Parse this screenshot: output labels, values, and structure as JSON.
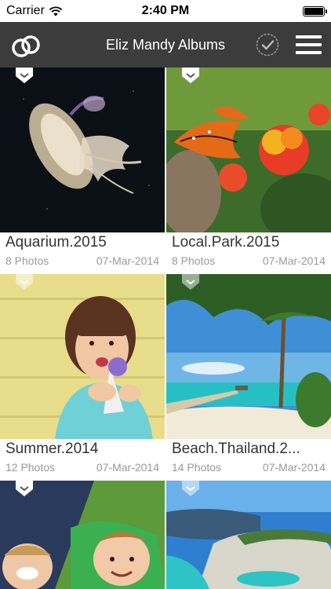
{
  "status_bar": {
    "carrier": "Carrier",
    "time": "2:40 PM",
    "wifi_icon": "wifi-icon",
    "battery_icon": "battery-icon"
  },
  "nav": {
    "title": "Eliz Mandy Albums",
    "logo_icon": "linked-rings-logo-icon",
    "select_icon": "checkmark-circle-icon",
    "menu_icon": "hamburger-menu-icon",
    "background": "#3c3c3c"
  },
  "albums": [
    {
      "title": "Aquarium.2015",
      "count": "8 Photos",
      "date": "07-Mar-2014",
      "image": "jellyfish"
    },
    {
      "title": "Local.Park.2015",
      "count": "8 Photos",
      "date": "07-Mar-2014",
      "image": "butterfly on flowers"
    },
    {
      "title": "Summer.2014",
      "count": "12 Photos",
      "date": "07-Mar-2014",
      "image": "child eating shaved ice"
    },
    {
      "title": "Beach.Thailand.2...",
      "count": "14 Photos",
      "date": "07-Mar-2014",
      "image": "tropical beach with pier"
    },
    {
      "title": "",
      "count": "",
      "date": "",
      "image": "two children lying on grass"
    },
    {
      "title": "",
      "count": "",
      "date": "",
      "image": "cliff cove with turquoise sea"
    }
  ]
}
